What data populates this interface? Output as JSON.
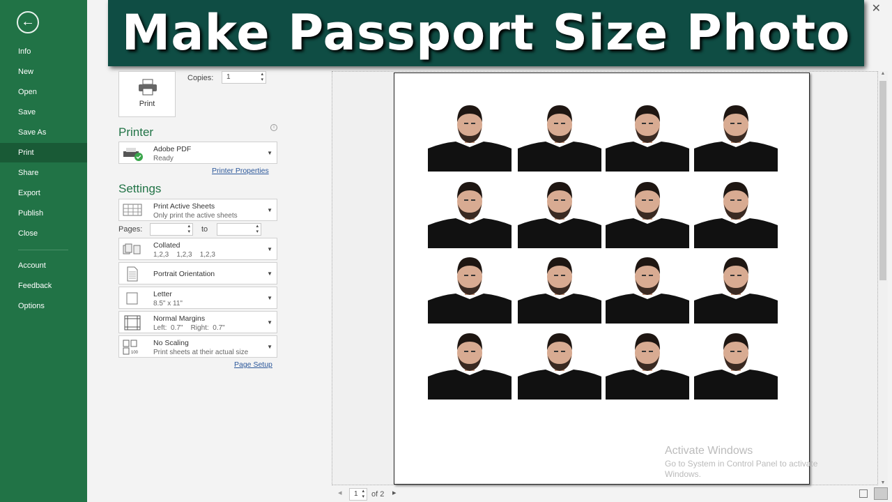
{
  "sidebar": {
    "items": [
      {
        "label": "Info"
      },
      {
        "label": "New"
      },
      {
        "label": "Open"
      },
      {
        "label": "Save"
      },
      {
        "label": "Save As"
      },
      {
        "label": "Print"
      },
      {
        "label": "Share"
      },
      {
        "label": "Export"
      },
      {
        "label": "Publish"
      },
      {
        "label": "Close"
      },
      {
        "label": "Account"
      },
      {
        "label": "Feedback"
      },
      {
        "label": "Options"
      }
    ],
    "active": "Print",
    "color": "#217346"
  },
  "banner": {
    "title": "Make Passport Size Photo",
    "color": "#0f4d44"
  },
  "print": {
    "button_label": "Print",
    "copies_label": "Copies:",
    "copies_value": "1"
  },
  "printer": {
    "heading": "Printer",
    "name": "Adobe PDF",
    "status": "Ready",
    "properties_link": "Printer Properties"
  },
  "settings": {
    "heading": "Settings",
    "what": {
      "title": "Print Active Sheets",
      "sub": "Only print the active sheets"
    },
    "pages_label": "Pages:",
    "to_label": "to",
    "pages_from": "",
    "pages_to": "",
    "collated": {
      "title": "Collated",
      "sub": "1,2,3    1,2,3    1,2,3"
    },
    "orientation": {
      "title": "Portrait Orientation"
    },
    "paper": {
      "title": "Letter",
      "sub": "8.5\" x 11\""
    },
    "margins": {
      "title": "Normal Margins",
      "sub": "Left:  0.7\"    Right:  0.7\""
    },
    "scaling": {
      "title": "No Scaling",
      "sub": "Print sheets at their actual size"
    },
    "page_setup_link": "Page Setup"
  },
  "preview": {
    "photo_rows": 4,
    "photo_cols": 4,
    "current_page": "1",
    "of_pages": "of 2"
  },
  "watermark": {
    "title": "Activate Windows",
    "line1": "Go to System in Control Panel to activate",
    "line2": "Windows."
  }
}
